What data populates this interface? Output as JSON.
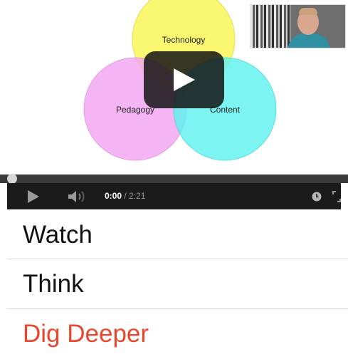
{
  "video": {
    "venn_labels": {
      "top": "Technology",
      "left": "Pedagogy",
      "right": "Content"
    },
    "colors": {
      "top_circle": "#fbf76a",
      "left_circle": "#f3a6f2",
      "right_circle": "#5ff2f0",
      "accent_active": "#e8462d"
    },
    "player": {
      "current_time": "0:00",
      "separator": " / ",
      "duration": "2:21",
      "progress_fraction": 0
    }
  },
  "menu": {
    "items": [
      {
        "label": "Watch"
      },
      {
        "label": "Think"
      },
      {
        "label": "Dig Deeper"
      }
    ],
    "active_index": 2
  }
}
